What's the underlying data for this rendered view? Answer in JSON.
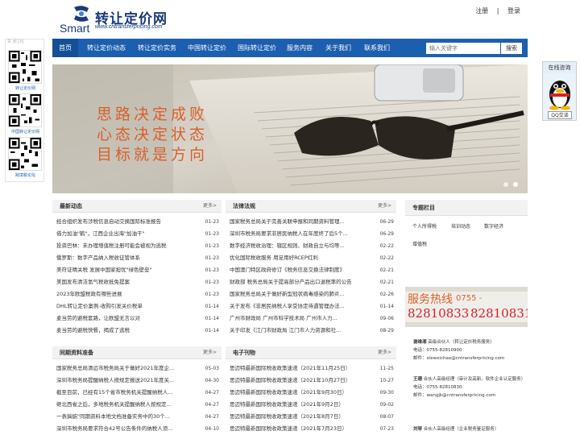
{
  "header": {
    "logo_smart": "Smart",
    "logo_cn": "转让定价网",
    "logo_url": "www.cntransferpricing.com",
    "register": "注册",
    "separator": "|",
    "login": "登录"
  },
  "nav": {
    "items": [
      "首页",
      "转让定价动态",
      "转让定价实务",
      "中国转让定价",
      "国际转让定价",
      "服务内容",
      "关于我们",
      "联系我们"
    ],
    "search_placeholder": "输入关键字",
    "search_button": "搜索"
  },
  "qr_panel": {
    "top_label": "关 闭 [X]",
    "caption1": "转让定价网",
    "caption2": "中国转让定价网",
    "caption3": "跨境税论坛"
  },
  "banner": {
    "line1": "思路决定成败",
    "line2": "心态决定状态",
    "line3": "目标就是方向"
  },
  "online": {
    "title": "在线咨询",
    "qq": "QQ交谈"
  },
  "news": {
    "title": "最新动态",
    "more": "更多>",
    "rows": [
      {
        "text": "经合组织发布涉税信息自动交换国际标准报告",
        "date": "01-23"
      },
      {
        "text": "借力加油\"鹤\"，江西企业出海\"加油干\"",
        "date": "01-23"
      },
      {
        "text": "投资巴林：未办理增值税注册可能会被视为逃税",
        "date": "01-23"
      },
      {
        "text": "俄罗斯：数字产品纳入税收征管体系",
        "date": "01-23"
      },
      {
        "text": "美符证晴关税 发展中国家担忧\"绿色壁垒\"",
        "date": "01-23"
      },
      {
        "text": "美国发布清洁氢气税收抵免提案",
        "date": "01-23"
      },
      {
        "text": "2023年欧盟税政有哪些进展",
        "date": "01-23"
      },
      {
        "text": "DHL转让定价案例-收购引发关价税单",
        "date": "01-14"
      },
      {
        "text": "麦当劳的避税套路，让欧盟无言以对",
        "date": "01-14"
      },
      {
        "text": "麦当劳的避税快餐，揭成了逃税",
        "date": "01-14"
      }
    ]
  },
  "laws": {
    "title": "法律法规",
    "more": "更多>",
    "rows": [
      {
        "text": "国家税务总局关于完善关联申报和同期资料管理...",
        "date": "06-29"
      },
      {
        "text": "深圳市税务局要求非居民纳税人在年度终了后5个...",
        "date": "06-29"
      },
      {
        "text": "数字经济税收治理：辖区规则、财政自立与均等...",
        "date": "02-22"
      },
      {
        "text": "优化国际税收服务 用足用好RCEP红利",
        "date": "02-22"
      },
      {
        "text": "中国澳门特区政府修订《税务信息交换法律制度》",
        "date": "02-21"
      },
      {
        "text": "财政部 税务总局关于提高部分产品出口退税率的公告",
        "date": "02-21"
      },
      {
        "text": "国家税务总局关于做好新型冠状病毒感染的肺炎...",
        "date": "02-26"
      },
      {
        "text": "关于发布《非居民纳税人享受协定待遇管理办法...",
        "date": "01-14"
      },
      {
        "text": "广州市财政局 广州市科学技术局 广州市人力...",
        "date": "09-06"
      },
      {
        "text": "关于印发《江门市财政局 江门市人力资源和社...",
        "date": "08-29"
      }
    ]
  },
  "prep": {
    "title": "同期资料准备",
    "more": "更多>",
    "rows": [
      {
        "text": "国家税务总局清远市税务局关于做好2021年度企...",
        "date": "05-03"
      },
      {
        "text": "深圳市税务局提醒纳税人按规定报送2021年度关...",
        "date": "04-30"
      },
      {
        "text": "截至目前，已经有15个省市税务机关提醒纳税人...",
        "date": "04-27"
      },
      {
        "text": "继北西省之后，多地税务机关提醒纳税人按规定...",
        "date": "04-27"
      },
      {
        "text": "一表搞掂\"同期资料本地文档准备实务中的30个...",
        "date": "04-27"
      },
      {
        "text": "深圳市税务局要求符合42号公告条件的纳税人须...",
        "date": "04-10"
      }
    ]
  },
  "ejournal": {
    "title": "电子刊物",
    "more": "更多>",
    "rows": [
      {
        "text": "思迈特最新国际税收政策速递（2021年11月25日）",
        "date": "11-25"
      },
      {
        "text": "思迈特最新国际税收政策速递（2021年10月27日）",
        "date": "10-27"
      },
      {
        "text": "思迈特最新国际税收政策速递（2021年9月30日）",
        "date": "09-30"
      },
      {
        "text": "思迈特最新国际税收政策速递（2021年9月2日）",
        "date": "09-02"
      },
      {
        "text": "思迈特最新国际税收政策速递（2021年8月7日）",
        "date": "08-07"
      },
      {
        "text": "思迈特最新国际税收政策速递（2021年7月23日）",
        "date": "07-23"
      }
    ]
  },
  "topics": {
    "title": "专题栏目",
    "tags": [
      "个人所得税",
      "培训动态",
      "数字经济",
      "增值税"
    ]
  },
  "hotline": {
    "label": "服务热线",
    "code": "0755 -",
    "num1": "82810833",
    "num2": "82810831"
  },
  "contacts": [
    {
      "name": "谢维湘",
      "title": "高级合伙人（转让定价税务服务）",
      "phone": "电话：0755-82810900",
      "email": "邮件：xiewxichao@cntransferpricing.com"
    },
    {
      "name": "王珊",
      "title": "合伙人高级经理（审计及高新、软件企业认定服务）",
      "phone": "电话：0755-82810830",
      "email": "邮件：wangjk@cntransferpricing.com"
    },
    {
      "name": "刘琴",
      "title": "合伙人高级经理（企业税务鉴证服务）",
      "phone": "",
      "email": ""
    }
  ]
}
